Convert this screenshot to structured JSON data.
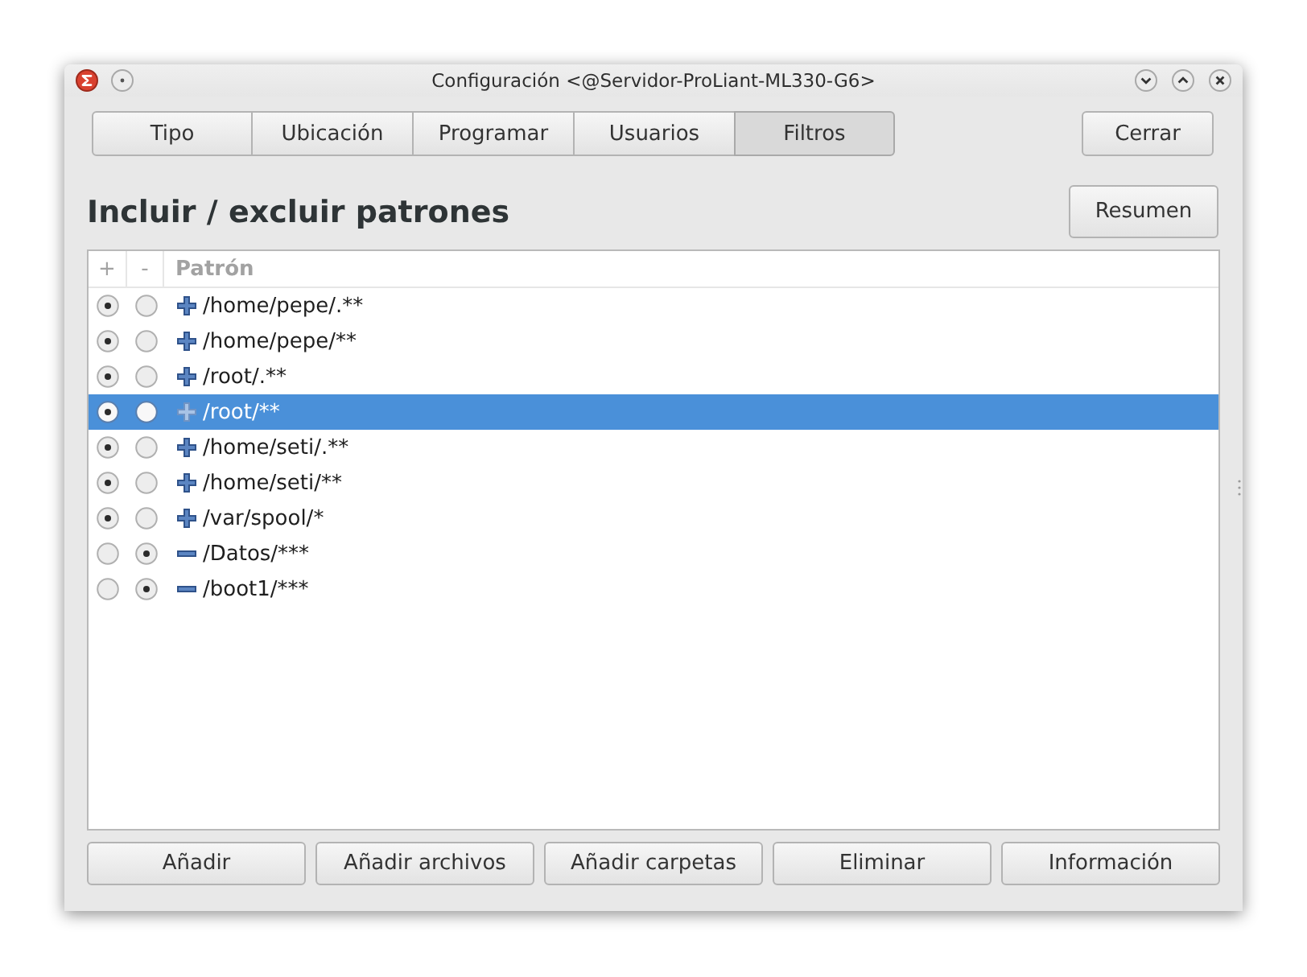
{
  "window": {
    "title": "Configuración <@Servidor-ProLiant-ML330-G6>"
  },
  "tabs": [
    {
      "label": "Tipo",
      "selected": false
    },
    {
      "label": "Ubicación",
      "selected": false
    },
    {
      "label": "Programar",
      "selected": false
    },
    {
      "label": "Usuarios",
      "selected": false
    },
    {
      "label": "Filtros",
      "selected": true
    }
  ],
  "close_button": {
    "label": "Cerrar"
  },
  "heading": "Incluir / excluir patrones",
  "summary_button": {
    "label": "Resumen"
  },
  "table": {
    "columns": [
      "+",
      "-",
      "Patrón"
    ],
    "rows": [
      {
        "include": true,
        "pattern": "/home/pepe/.**",
        "selected": false
      },
      {
        "include": true,
        "pattern": "/home/pepe/**",
        "selected": false
      },
      {
        "include": true,
        "pattern": "/root/.**",
        "selected": false
      },
      {
        "include": true,
        "pattern": "/root/**",
        "selected": true
      },
      {
        "include": true,
        "pattern": "/home/seti/.**",
        "selected": false
      },
      {
        "include": true,
        "pattern": "/home/seti/**",
        "selected": false
      },
      {
        "include": true,
        "pattern": "/var/spool/*",
        "selected": false
      },
      {
        "include": false,
        "pattern": "/Datos/***",
        "selected": false
      },
      {
        "include": false,
        "pattern": "/boot1/***",
        "selected": false
      }
    ]
  },
  "buttons": [
    {
      "label": "Añadir"
    },
    {
      "label": "Añadir archivos"
    },
    {
      "label": "Añadir carpetas"
    },
    {
      "label": "Eliminar"
    },
    {
      "label": "Información"
    }
  ]
}
